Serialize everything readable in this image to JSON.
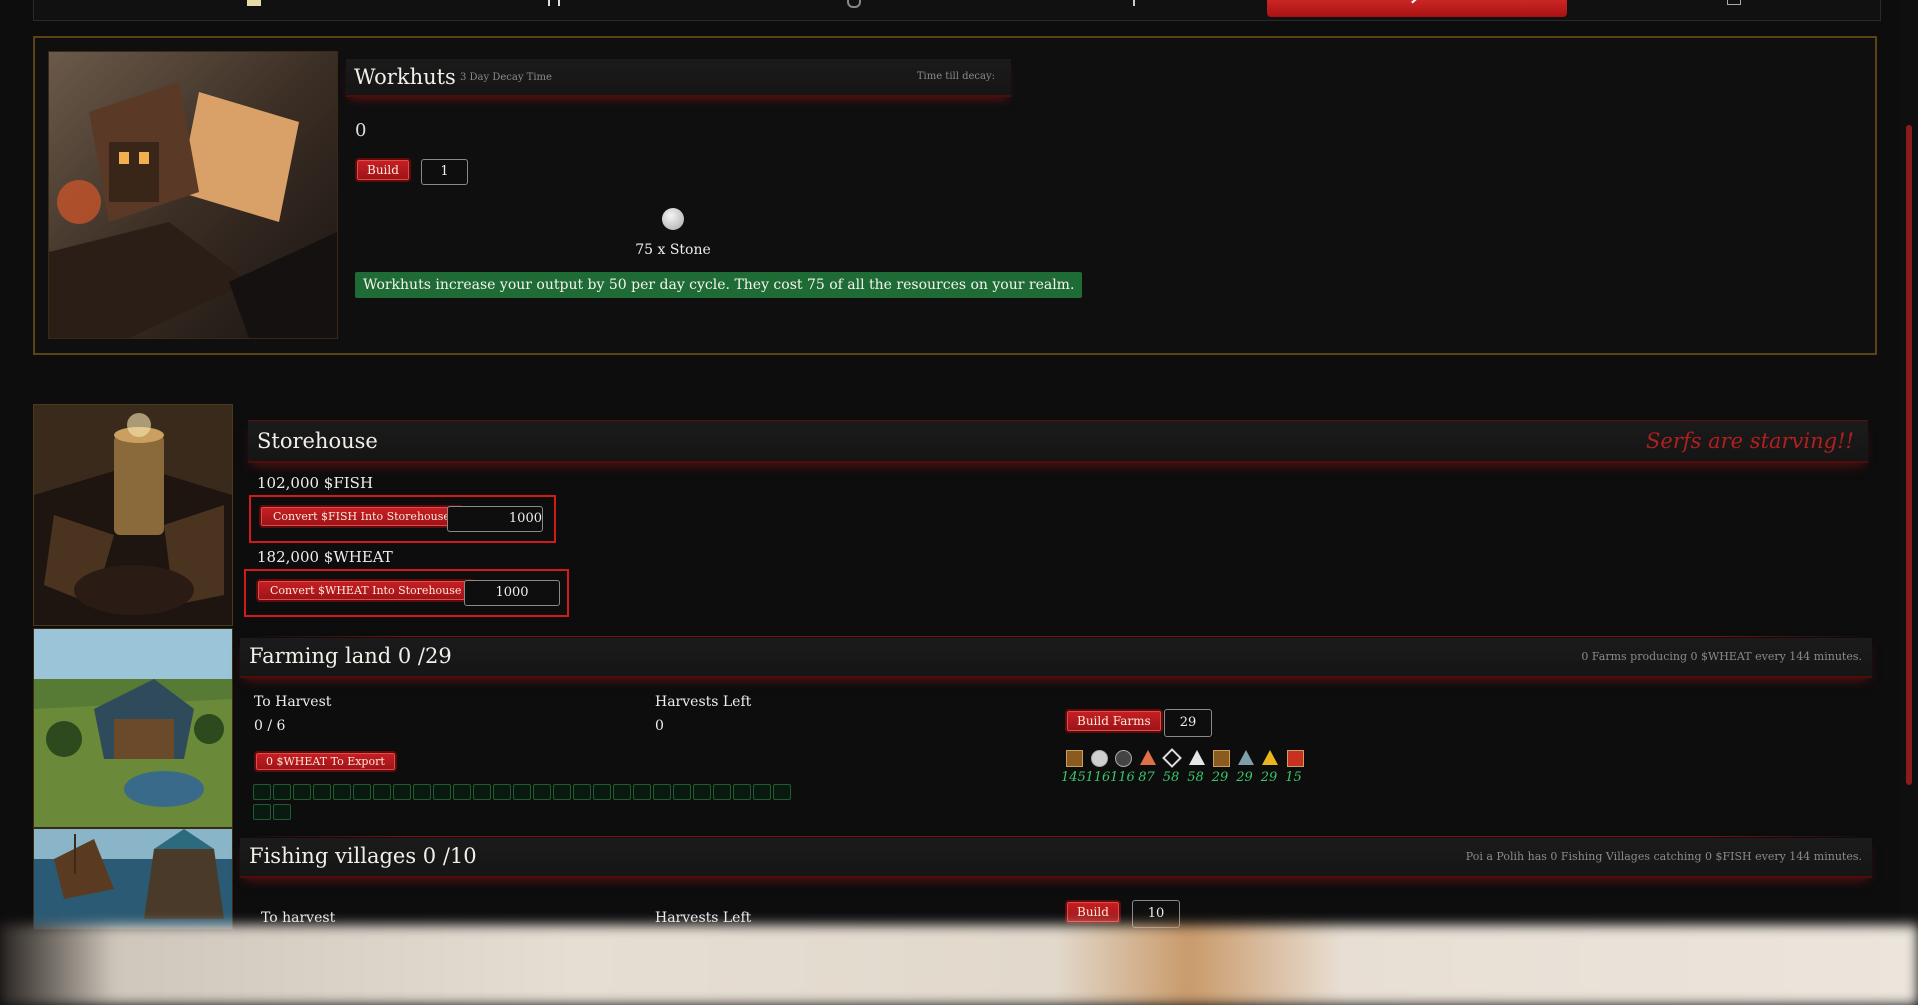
{
  "tabs": [
    {
      "label": "",
      "icon": "scroll-icon",
      "active": false
    },
    {
      "label": "",
      "icon": "tower-icon",
      "active": false
    },
    {
      "label": "",
      "icon": "shield-icon",
      "active": false
    },
    {
      "label": "",
      "icon": "sword-icon",
      "active": false
    },
    {
      "label": "",
      "icon": "hammer-icon",
      "active": true
    },
    {
      "label": "",
      "icon": "book-icon",
      "active": false
    }
  ],
  "workhuts": {
    "title": "Workhuts",
    "decay_label": "3 Day Decay Time",
    "time_till_decay_label": "Time till decay:",
    "count": "0",
    "build_label": "Build",
    "build_quantity": "1",
    "cost_text": "75 x Stone",
    "note": "Workhuts increase your output by 50 per day cycle. They cost 75 of all the resources on your realm."
  },
  "storehouse": {
    "title": "Storehouse",
    "warning": "Serfs are starving!!",
    "fish_amount": "102,000 $FISH",
    "fish_button": "Convert $FISH Into Storehouse",
    "fish_input": "1000",
    "wheat_amount": "182,000 $WHEAT",
    "wheat_button": "Convert $WHEAT Into Storehouse",
    "wheat_input": "1000"
  },
  "farming": {
    "title": "Farming land 0 /29",
    "status": "0 Farms producing 0 $WHEAT every 144 minutes.",
    "to_harvest_label": "To Harvest",
    "to_harvest_value": "0 / 6",
    "harvests_left_label": "Harvests Left",
    "harvests_left_value": "0",
    "export_button": "0 $WHEAT To Export",
    "build_button": "Build Farms",
    "build_quantity": "29",
    "resources": [
      {
        "icon": "wood-icon",
        "color": "#8a5a1e",
        "value": "145"
      },
      {
        "icon": "stone-icon",
        "color": "#cfcfcf",
        "value": "116"
      },
      {
        "icon": "coal-icon",
        "color": "#444444",
        "value": "116"
      },
      {
        "icon": "copper-icon",
        "color": "#e0704a",
        "value": "87"
      },
      {
        "icon": "obsidian-icon",
        "color": "#dddddd",
        "value": "58"
      },
      {
        "icon": "silver-icon",
        "color": "#e6e6e6",
        "value": "58"
      },
      {
        "icon": "ironwood-icon",
        "color": "#8a5a1e",
        "value": "29"
      },
      {
        "icon": "cold-iron-icon",
        "color": "#7ea0a8",
        "value": "29"
      },
      {
        "icon": "gold-icon",
        "color": "#e8b51e",
        "value": "29"
      },
      {
        "icon": "hartwood-icon",
        "color": "#c83020",
        "value": "15"
      }
    ]
  },
  "fishing": {
    "title": "Fishing villages 0 /10",
    "status": "Poi a Polih has 0 Fishing Villages catching 0 $FISH every 144 minutes.",
    "to_harvest_label": "To harvest",
    "harvests_left_label": "Harvests Left",
    "build_button": "Build",
    "build_quantity": "10"
  }
}
